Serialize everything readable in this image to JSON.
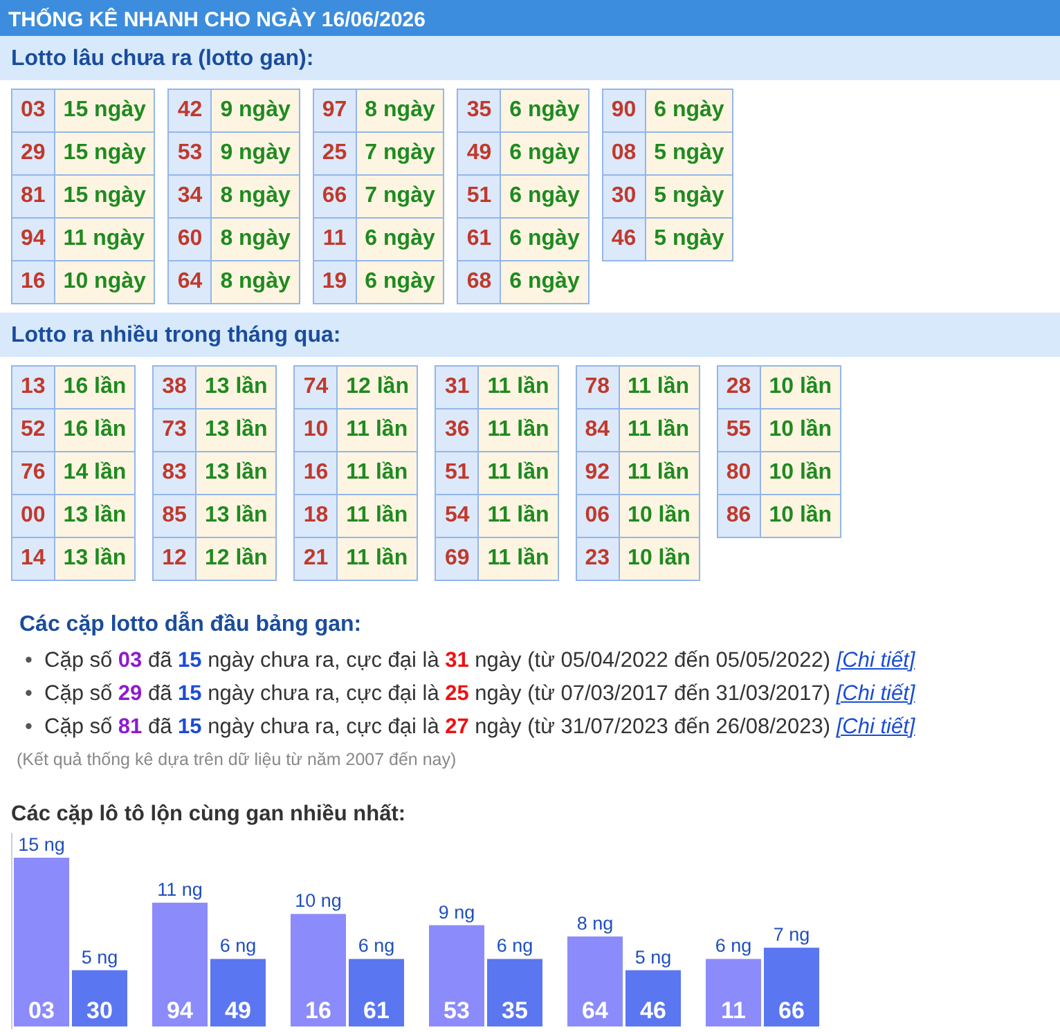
{
  "header": {
    "title": "THỐNG KÊ NHANH CHO NGÀY 16/06/2026"
  },
  "gan_section": {
    "title": "Lotto lâu chưa ra (lotto gan):",
    "groups": [
      [
        {
          "number": "03",
          "value": "15 ngày"
        },
        {
          "number": "29",
          "value": "15 ngày"
        },
        {
          "number": "81",
          "value": "15 ngày"
        },
        {
          "number": "94",
          "value": "11 ngày"
        },
        {
          "number": "16",
          "value": "10 ngày"
        }
      ],
      [
        {
          "number": "42",
          "value": "9 ngày"
        },
        {
          "number": "53",
          "value": "9 ngày"
        },
        {
          "number": "34",
          "value": "8 ngày"
        },
        {
          "number": "60",
          "value": "8 ngày"
        },
        {
          "number": "64",
          "value": "8 ngày"
        }
      ],
      [
        {
          "number": "97",
          "value": "8 ngày"
        },
        {
          "number": "25",
          "value": "7 ngày"
        },
        {
          "number": "66",
          "value": "7 ngày"
        },
        {
          "number": "11",
          "value": "6 ngày"
        },
        {
          "number": "19",
          "value": "6 ngày"
        }
      ],
      [
        {
          "number": "35",
          "value": "6 ngày"
        },
        {
          "number": "49",
          "value": "6 ngày"
        },
        {
          "number": "51",
          "value": "6 ngày"
        },
        {
          "number": "61",
          "value": "6 ngày"
        },
        {
          "number": "68",
          "value": "6 ngày"
        }
      ],
      [
        {
          "number": "90",
          "value": "6 ngày"
        },
        {
          "number": "08",
          "value": "5 ngày"
        },
        {
          "number": "30",
          "value": "5 ngày"
        },
        {
          "number": "46",
          "value": "5 ngày"
        }
      ]
    ]
  },
  "frequent_section": {
    "title": "Lotto ra nhiều trong tháng qua:",
    "groups": [
      [
        {
          "number": "13",
          "value": "16 lần"
        },
        {
          "number": "52",
          "value": "16 lần"
        },
        {
          "number": "76",
          "value": "14 lần"
        },
        {
          "number": "00",
          "value": "13 lần"
        },
        {
          "number": "14",
          "value": "13 lần"
        }
      ],
      [
        {
          "number": "38",
          "value": "13 lần"
        },
        {
          "number": "73",
          "value": "13 lần"
        },
        {
          "number": "83",
          "value": "13 lần"
        },
        {
          "number": "85",
          "value": "13 lần"
        },
        {
          "number": "12",
          "value": "12 lần"
        }
      ],
      [
        {
          "number": "74",
          "value": "12 lần"
        },
        {
          "number": "10",
          "value": "11 lần"
        },
        {
          "number": "16",
          "value": "11 lần"
        },
        {
          "number": "18",
          "value": "11 lần"
        },
        {
          "number": "21",
          "value": "11 lần"
        }
      ],
      [
        {
          "number": "31",
          "value": "11 lần"
        },
        {
          "number": "36",
          "value": "11 lần"
        },
        {
          "number": "51",
          "value": "11 lần"
        },
        {
          "number": "54",
          "value": "11 lần"
        },
        {
          "number": "69",
          "value": "11 lần"
        }
      ],
      [
        {
          "number": "78",
          "value": "11 lần"
        },
        {
          "number": "84",
          "value": "11 lần"
        },
        {
          "number": "92",
          "value": "11 lần"
        },
        {
          "number": "06",
          "value": "10 lần"
        },
        {
          "number": "23",
          "value": "10 lần"
        }
      ],
      [
        {
          "number": "28",
          "value": "10 lần"
        },
        {
          "number": "55",
          "value": "10 lần"
        },
        {
          "number": "80",
          "value": "10 lần"
        },
        {
          "number": "86",
          "value": "10 lần"
        }
      ]
    ]
  },
  "leaders": {
    "title": "Các cặp lotto dẫn đầu bảng gan:",
    "items": [
      {
        "marker": "•",
        "text": "Cặp số **03** đã **15** ngày chưa ra, cực đại là **31** ngày (từ 05/04/2022 đến 05/05/2022)",
        "link": "[Chi tiết]"
      },
      {
        "marker": "•",
        "text": "Cặp số **29** đã **15** ngày chưa ra, cực đại là **25** ngày (từ 07/03/2017 đến 31/03/2017)",
        "link": "[Chi tiết]"
      },
      {
        "marker": "•",
        "text": "Cặp số **81** đã **15** ngày chưa ra, cực đại là **27** ngày (từ 31/07/2023 đến 26/08/2023)",
        "link": "[Chi tiết]"
      }
    ],
    "note": "(Kết quả thống kê dựa trên dữ liệu từ năm 2007 đến nay)"
  },
  "pairs_section": {
    "title": "Các cặp lô tô lộn cùng gan nhiều nhất:",
    "chart_data": {
      "type": "bar",
      "categories": [
        "03",
        "30",
        "94",
        "49",
        "16",
        "61",
        "53",
        "35",
        "64",
        "46",
        "11",
        "66"
      ],
      "series": [
        {
          "color": "#8b8bfb",
          "values": [
            15,
            null,
            11,
            null,
            10,
            null,
            9,
            null,
            8,
            null,
            6,
            null
          ],
          "value_labels": [
            "15 ng",
            null,
            "11 ng",
            null,
            "10 ng",
            null,
            "9 ng",
            null,
            "8 ng",
            null,
            "6 ng",
            null
          ]
        },
        {
          "color": "#5a76f0",
          "values": [
            null,
            5,
            null,
            6,
            null,
            6,
            null,
            6,
            null,
            5,
            null,
            7
          ],
          "value_labels": [
            null,
            "5 ng",
            null,
            "6 ng",
            null,
            "6 ng",
            null,
            "6 ng",
            null,
            "5 ng",
            null,
            "7 ng"
          ]
        }
      ]
    }
  }
}
